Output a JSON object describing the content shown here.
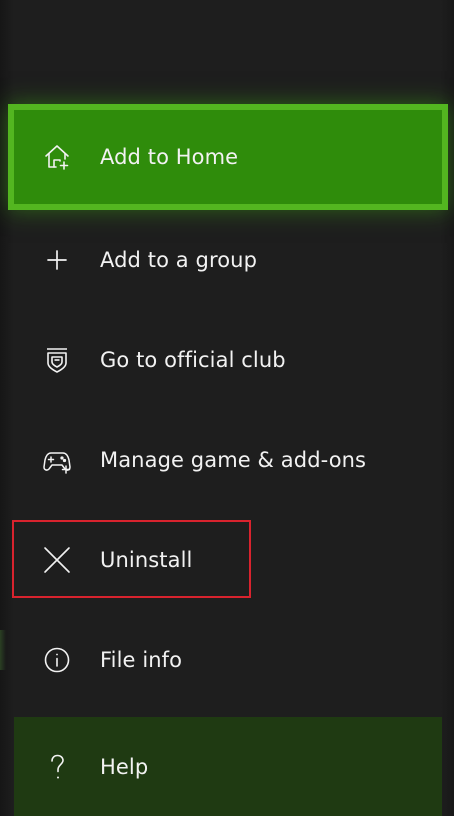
{
  "menu": {
    "items": [
      {
        "id": "add-to-home",
        "label": "Add to Home",
        "icon": "home-add-icon",
        "state": "focused"
      },
      {
        "id": "add-to-group",
        "label": "Add to a group",
        "icon": "plus-icon"
      },
      {
        "id": "official-club",
        "label": "Go to official club",
        "icon": "club-shield-icon"
      },
      {
        "id": "manage-game",
        "label": "Manage game & add-ons",
        "icon": "controller-icon"
      },
      {
        "id": "uninstall",
        "label": "Uninstall",
        "icon": "close-icon"
      },
      {
        "id": "file-info",
        "label": "File info",
        "icon": "info-icon"
      },
      {
        "id": "help",
        "label": "Help",
        "icon": "question-icon"
      }
    ]
  },
  "colors": {
    "background": "#1e1e1e",
    "focus": "#2f8c0b",
    "focus_border": "#53b620",
    "help_background": "#1f3a12",
    "annotation": "#d9232e",
    "text": "#f2f2f2"
  }
}
